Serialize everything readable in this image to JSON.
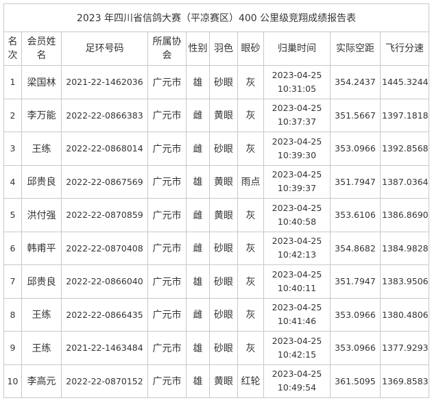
{
  "title": "2023 年四川省信鸽大赛（平凉赛区）400 公里级竞翔成绩报告表",
  "headers": {
    "rank": "名次",
    "name": "会员姓名",
    "ring": "足环号码",
    "assoc": "所属协会",
    "sex": "性别",
    "feather": "羽色",
    "eye": "眼砂",
    "time": "归巢时间",
    "dist": "实际空距",
    "speed": "飞行分速"
  },
  "rows": [
    {
      "rank": "1",
      "name": "梁国林",
      "ring": "2021-22-1462036",
      "assoc": "广元市",
      "sex": "雄",
      "feather": "砂眼",
      "eye": "灰",
      "date": "2023-04-25",
      "time": "10:31:05",
      "dist": "354.2437",
      "speed": "1445.3244"
    },
    {
      "rank": "2",
      "name": "李万能",
      "ring": "2022-22-0866383",
      "assoc": "广元市",
      "sex": "雌",
      "feather": "黄眼",
      "eye": "灰",
      "date": "2023-04-25",
      "time": "10:37:37",
      "dist": "351.5667",
      "speed": "1397.1818"
    },
    {
      "rank": "3",
      "name": "王练",
      "ring": "2022-22-0868014",
      "assoc": "广元市",
      "sex": "雌",
      "feather": "砂眼",
      "eye": "灰",
      "date": "2023-04-25",
      "time": "10:39:30",
      "dist": "353.0966",
      "speed": "1392.8568"
    },
    {
      "rank": "4",
      "name": "邱贵良",
      "ring": "2022-22-0867569",
      "assoc": "广元市",
      "sex": "雄",
      "feather": "黄眼",
      "eye": "雨点",
      "date": "2023-04-25",
      "time": "10:39:37",
      "dist": "351.7947",
      "speed": "1387.0364"
    },
    {
      "rank": "5",
      "name": "洪付强",
      "ring": "2022-22-0870859",
      "assoc": "广元市",
      "sex": "雌",
      "feather": "黄眼",
      "eye": "灰",
      "date": "2023-04-25",
      "time": "10:40:58",
      "dist": "353.6106",
      "speed": "1386.8690"
    },
    {
      "rank": "6",
      "name": "韩甫平",
      "ring": "2022-22-0870408",
      "assoc": "广元市",
      "sex": "雌",
      "feather": "砂眼",
      "eye": "灰",
      "date": "2023-04-25",
      "time": "10:42:13",
      "dist": "354.8682",
      "speed": "1384.9828"
    },
    {
      "rank": "7",
      "name": "邱贵良",
      "ring": "2022-22-0866040",
      "assoc": "广元市",
      "sex": "雄",
      "feather": "砂眼",
      "eye": "灰",
      "date": "2023-04-25",
      "time": "10:40:11",
      "dist": "351.7947",
      "speed": "1383.9506"
    },
    {
      "rank": "8",
      "name": "王练",
      "ring": "2022-22-0866435",
      "assoc": "广元市",
      "sex": "雌",
      "feather": "砂眼",
      "eye": "灰",
      "date": "2023-04-25",
      "time": "10:41:46",
      "dist": "353.0966",
      "speed": "1380.4806"
    },
    {
      "rank": "9",
      "name": "王练",
      "ring": "2021-22-1463484",
      "assoc": "广元市",
      "sex": "雄",
      "feather": "砂眼",
      "eye": "灰",
      "date": "2023-04-25",
      "time": "10:42:15",
      "dist": "353.0966",
      "speed": "1377.9293"
    },
    {
      "rank": "10",
      "name": "李高元",
      "ring": "2022-22-0870152",
      "assoc": "广元市",
      "sex": "雄",
      "feather": "黄眼",
      "eye": "红轮",
      "date": "2023-04-25",
      "time": "10:49:54",
      "dist": "361.5095",
      "speed": "1369.8583"
    }
  ]
}
